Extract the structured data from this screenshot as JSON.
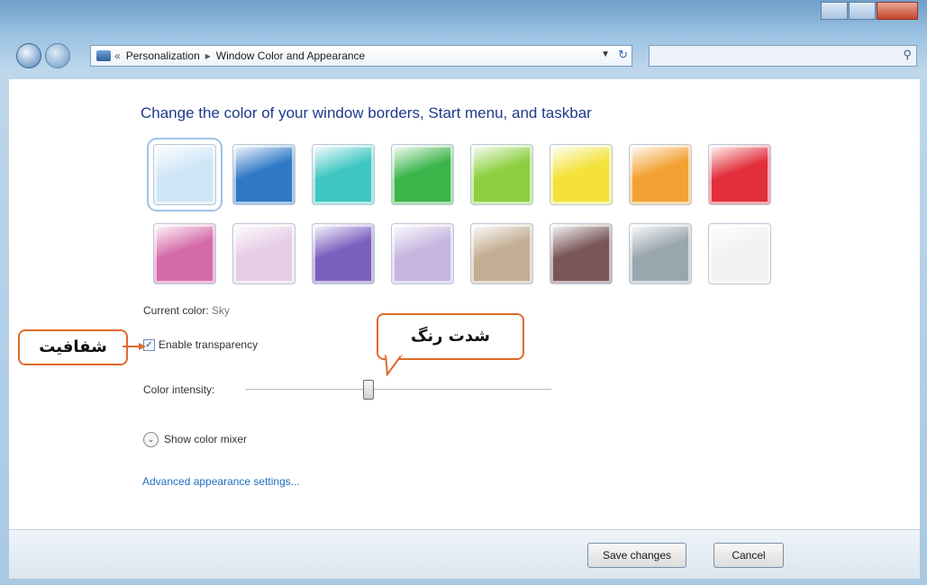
{
  "window": {
    "breadcrumb": [
      "Personalization",
      "Window Color and Appearance"
    ],
    "breadcrumb_separator": "▸",
    "breadcrumb_prefix": "«",
    "search_placeholder": ""
  },
  "main": {
    "heading": "Change the color of your window borders, Start menu, and taskbar",
    "current_color_label": "Current color:",
    "current_color_value": "Sky",
    "enable_transparency_label": "Enable transparency",
    "enable_transparency_checked": true,
    "color_intensity_label": "Color intensity:",
    "color_intensity_level": 0.4,
    "show_color_mixer_label": "Show color mixer",
    "advanced_link": "Advanced appearance settings..."
  },
  "swatches": [
    {
      "name": "sky",
      "color": "#cfe6f7",
      "selected": true
    },
    {
      "name": "twilight",
      "color": "#2e78c6"
    },
    {
      "name": "sea",
      "color": "#3fc6c2"
    },
    {
      "name": "leaf",
      "color": "#3bb54a"
    },
    {
      "name": "lime",
      "color": "#8ccf3f"
    },
    {
      "name": "lemon",
      "color": "#f4e23a"
    },
    {
      "name": "pumpkin",
      "color": "#f3a132"
    },
    {
      "name": "ruby",
      "color": "#e22f3b"
    },
    {
      "name": "fuchsia",
      "color": "#d56aa9"
    },
    {
      "name": "blush",
      "color": "#e6cde6"
    },
    {
      "name": "violet",
      "color": "#7b5fbd"
    },
    {
      "name": "lavender",
      "color": "#c6b6e0"
    },
    {
      "name": "taupe",
      "color": "#c3ad93"
    },
    {
      "name": "chocolate",
      "color": "#7a5659"
    },
    {
      "name": "slate",
      "color": "#9aa6ae"
    },
    {
      "name": "frost",
      "color": "#f2f2f2"
    }
  ],
  "footer": {
    "save_label": "Save changes",
    "cancel_label": "Cancel"
  },
  "annotations": {
    "transparency_callout": "شفافیت",
    "intensity_callout": "شدت رنگ",
    "callout_border_color": "#e06a2a"
  }
}
